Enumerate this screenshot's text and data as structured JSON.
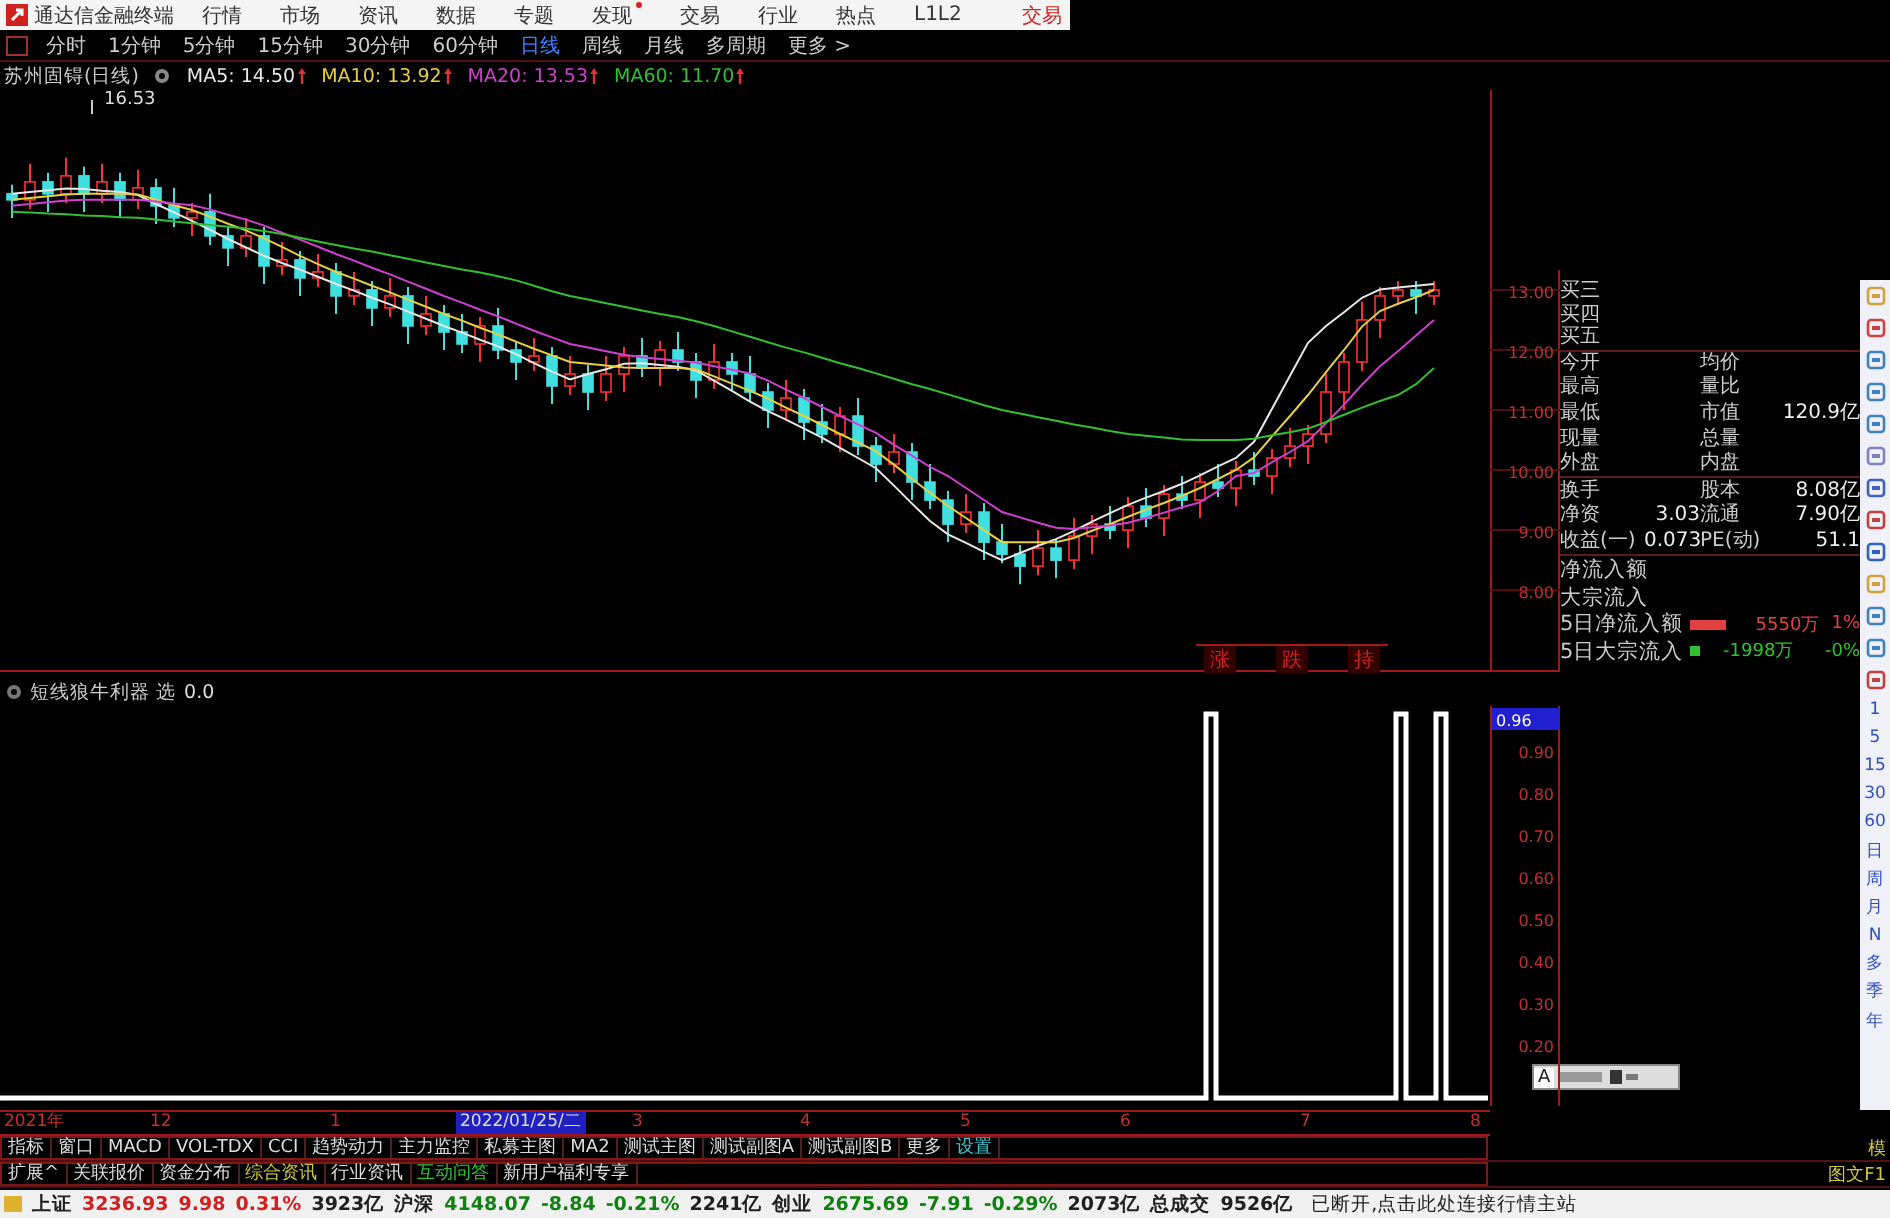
{
  "menu": {
    "title": "通达信金融终端",
    "items": [
      {
        "label": "行情",
        "badge": false
      },
      {
        "label": "市场",
        "badge": false
      },
      {
        "label": "资讯",
        "badge": false
      },
      {
        "label": "数据",
        "badge": false
      },
      {
        "label": "专题",
        "badge": false
      },
      {
        "label": "发现",
        "badge": true
      },
      {
        "label": "交易",
        "badge": false
      },
      {
        "label": "行业",
        "badge": false
      },
      {
        "label": "热点",
        "badge": false
      },
      {
        "label": "L1L2",
        "badge": false
      }
    ],
    "trade": "交易"
  },
  "periods": [
    {
      "label": "分时",
      "selected": false
    },
    {
      "label": "1分钟",
      "selected": false
    },
    {
      "label": "5分钟",
      "selected": false
    },
    {
      "label": "15分钟",
      "selected": false
    },
    {
      "label": "30分钟",
      "selected": false
    },
    {
      "label": "60分钟",
      "selected": false
    },
    {
      "label": "日线",
      "selected": true
    },
    {
      "label": "周线",
      "selected": false
    },
    {
      "label": "月线",
      "selected": false
    },
    {
      "label": "多周期",
      "selected": false
    },
    {
      "label": "更多 >",
      "selected": false
    }
  ],
  "ma_bar": {
    "stock": "苏州固锝(日线)",
    "lines": [
      "MA5: 14.50",
      "MA10: 13.92",
      "MA20: 13.53",
      "MA60: 11.70"
    ]
  },
  "high_label": "16.53",
  "chart_tabs": [
    "涨",
    "跌",
    "持"
  ],
  "chart_data": {
    "type": "candlestick",
    "ylim": [
      6.67,
      16.33
    ],
    "ohlc": [
      [
        14.6,
        14.75,
        14.2,
        14.5
      ],
      [
        14.5,
        15.1,
        14.35,
        14.8
      ],
      [
        14.8,
        14.95,
        14.3,
        14.6
      ],
      [
        14.6,
        15.2,
        14.45,
        14.9
      ],
      [
        14.9,
        15.05,
        14.3,
        14.6
      ],
      [
        14.6,
        15.1,
        14.45,
        14.8
      ],
      [
        14.8,
        14.95,
        14.2,
        14.5
      ],
      [
        14.5,
        15.0,
        14.35,
        14.7
      ],
      [
        14.7,
        14.85,
        14.1,
        14.4
      ],
      [
        14.4,
        14.7,
        14.05,
        14.2
      ],
      [
        14.2,
        14.45,
        13.9,
        14.3
      ],
      [
        14.3,
        14.6,
        13.75,
        13.9
      ],
      [
        13.9,
        14.05,
        13.4,
        13.7
      ],
      [
        13.7,
        14.2,
        13.55,
        13.9
      ],
      [
        13.9,
        14.05,
        13.1,
        13.4
      ],
      [
        13.4,
        13.8,
        13.25,
        13.5
      ],
      [
        13.5,
        13.65,
        12.9,
        13.2
      ],
      [
        13.2,
        13.6,
        13.05,
        13.3
      ],
      [
        13.3,
        13.45,
        12.6,
        12.9
      ],
      [
        12.9,
        13.3,
        12.75,
        13.0
      ],
      [
        13.0,
        13.15,
        12.4,
        12.7
      ],
      [
        12.7,
        13.2,
        12.55,
        12.9
      ],
      [
        12.9,
        13.05,
        12.1,
        12.4
      ],
      [
        12.4,
        12.9,
        12.25,
        12.6
      ],
      [
        12.6,
        12.75,
        12.0,
        12.3
      ],
      [
        12.3,
        12.6,
        11.95,
        12.1
      ],
      [
        12.1,
        12.55,
        11.8,
        12.4
      ],
      [
        12.4,
        12.7,
        11.85,
        12.0
      ],
      [
        12.0,
        12.15,
        11.5,
        11.8
      ],
      [
        11.8,
        12.2,
        11.65,
        11.9
      ],
      [
        11.9,
        12.05,
        11.1,
        11.4
      ],
      [
        11.4,
        11.9,
        11.25,
        11.6
      ],
      [
        11.6,
        11.75,
        11.0,
        11.3
      ],
      [
        11.3,
        11.9,
        11.15,
        11.6
      ],
      [
        11.6,
        12.05,
        11.3,
        11.9
      ],
      [
        11.9,
        12.2,
        11.55,
        11.7
      ],
      [
        11.7,
        12.15,
        11.4,
        12.0
      ],
      [
        12.0,
        12.3,
        11.65,
        11.8
      ],
      [
        11.8,
        11.95,
        11.2,
        11.5
      ],
      [
        11.5,
        12.1,
        11.35,
        11.8
      ],
      [
        11.8,
        11.95,
        11.3,
        11.6
      ],
      [
        11.6,
        11.9,
        11.15,
        11.3
      ],
      [
        11.3,
        11.45,
        10.7,
        11.0
      ],
      [
        11.0,
        11.5,
        10.85,
        11.2
      ],
      [
        11.2,
        11.35,
        10.5,
        10.8
      ],
      [
        10.8,
        11.1,
        10.45,
        10.6
      ],
      [
        10.6,
        11.05,
        10.3,
        10.9
      ],
      [
        10.9,
        11.2,
        10.25,
        10.4
      ],
      [
        10.4,
        10.55,
        9.8,
        10.1
      ],
      [
        10.1,
        10.6,
        9.95,
        10.3
      ],
      [
        10.3,
        10.45,
        9.5,
        9.8
      ],
      [
        9.8,
        10.1,
        9.35,
        9.5
      ],
      [
        9.5,
        9.65,
        8.8,
        9.1
      ],
      [
        9.1,
        9.6,
        8.95,
        9.3
      ],
      [
        9.3,
        9.45,
        8.5,
        8.8
      ],
      [
        8.8,
        9.1,
        8.45,
        8.6
      ],
      [
        8.6,
        8.75,
        8.1,
        8.4
      ],
      [
        8.4,
        9.0,
        8.25,
        8.7
      ],
      [
        8.7,
        8.85,
        8.2,
        8.5
      ],
      [
        8.5,
        9.2,
        8.35,
        8.9
      ],
      [
        8.9,
        9.25,
        8.6,
        9.1
      ],
      [
        9.1,
        9.4,
        8.85,
        9.0
      ],
      [
        9.0,
        9.55,
        8.7,
        9.4
      ],
      [
        9.4,
        9.7,
        9.05,
        9.2
      ],
      [
        9.2,
        9.75,
        8.9,
        9.6
      ],
      [
        9.6,
        9.9,
        9.35,
        9.5
      ],
      [
        9.5,
        9.95,
        9.2,
        9.8
      ],
      [
        9.8,
        10.1,
        9.55,
        9.7
      ],
      [
        9.7,
        10.15,
        9.4,
        10.0
      ],
      [
        10.0,
        10.3,
        9.75,
        9.9
      ],
      [
        9.9,
        10.35,
        9.6,
        10.2
      ],
      [
        10.2,
        10.7,
        10.05,
        10.4
      ],
      [
        10.4,
        10.75,
        10.1,
        10.6
      ],
      [
        10.6,
        11.6,
        10.45,
        11.3
      ],
      [
        11.3,
        11.95,
        11.0,
        11.8
      ],
      [
        11.8,
        12.8,
        11.65,
        12.5
      ],
      [
        12.5,
        13.05,
        12.2,
        12.9
      ],
      [
        12.9,
        13.15,
        12.75,
        13.0
      ],
      [
        13.0,
        13.15,
        12.6,
        12.9
      ],
      [
        12.9,
        13.15,
        12.75,
        13.0
      ]
    ],
    "yticks": [
      {
        "value": 13,
        "label": "13.00"
      },
      {
        "value": 12,
        "label": "12.00"
      },
      {
        "value": 11,
        "label": "11.00"
      },
      {
        "value": 10,
        "label": "10.00"
      },
      {
        "value": 9,
        "label": "9.00"
      },
      {
        "value": 8,
        "label": "8.00"
      }
    ],
    "series": [
      {
        "type": "line",
        "color": "#e8e8e8",
        "values": [
          14.6,
          14.63,
          14.66,
          14.69,
          14.68,
          14.65,
          14.63,
          14.58,
          14.43,
          14.29,
          14.15,
          14.0,
          13.85,
          13.71,
          13.57,
          13.45,
          13.34,
          13.22,
          13.1,
          12.99,
          12.87,
          12.76,
          12.64,
          12.52,
          12.4,
          12.29,
          12.17,
          12.06,
          11.93,
          11.78,
          11.64,
          11.51,
          11.6,
          11.68,
          11.77,
          11.78,
          11.75,
          11.72,
          11.66,
          11.49,
          11.32,
          11.14,
          10.98,
          10.84,
          10.69,
          10.54,
          10.37,
          10.2,
          10.03,
          9.74,
          9.44,
          9.15,
          8.93,
          8.79,
          8.64,
          8.5,
          8.62,
          8.74,
          8.85,
          8.99,
          9.14,
          9.28,
          9.42,
          9.54,
          9.65,
          9.77,
          9.91,
          10.06,
          10.2,
          10.47,
          11.02,
          11.57,
          12.12,
          12.4,
          12.63,
          12.87,
          13.01,
          13.04,
          13.07,
          13.1
        ]
      },
      {
        "type": "line",
        "color": "#e8d040",
        "values": [
          14.5,
          14.53,
          14.56,
          14.59,
          14.6,
          14.6,
          14.6,
          14.59,
          14.5,
          14.41,
          14.33,
          14.22,
          14.1,
          13.99,
          13.86,
          13.72,
          13.57,
          13.43,
          13.3,
          13.19,
          13.07,
          12.96,
          12.84,
          12.72,
          12.6,
          12.49,
          12.37,
          12.26,
          12.14,
          12.02,
          11.91,
          11.8,
          11.77,
          11.74,
          11.71,
          11.7,
          11.7,
          11.7,
          11.68,
          11.56,
          11.44,
          11.32,
          11.19,
          11.04,
          10.9,
          10.75,
          10.6,
          10.46,
          10.31,
          10.09,
          9.85,
          9.62,
          9.4,
          9.2,
          9.0,
          8.8,
          8.8,
          8.8,
          8.8,
          8.87,
          8.99,
          9.1,
          9.22,
          9.34,
          9.45,
          9.57,
          9.7,
          9.85,
          10.0,
          10.21,
          10.56,
          10.9,
          11.25,
          11.63,
          12.0,
          12.39,
          12.65,
          12.77,
          12.88,
          13.0
        ]
      },
      {
        "type": "line",
        "color": "#d040d0",
        "values": [
          14.4,
          14.43,
          14.46,
          14.49,
          14.5,
          14.5,
          14.5,
          14.5,
          14.47,
          14.44,
          14.41,
          14.34,
          14.25,
          14.17,
          14.07,
          13.95,
          13.84,
          13.72,
          13.6,
          13.49,
          13.37,
          13.26,
          13.14,
          13.02,
          12.9,
          12.79,
          12.67,
          12.56,
          12.44,
          12.32,
          12.21,
          12.1,
          12.04,
          11.98,
          11.92,
          11.88,
          11.85,
          11.82,
          11.79,
          11.73,
          11.67,
          11.61,
          11.49,
          11.34,
          11.2,
          11.05,
          10.9,
          10.76,
          10.62,
          10.42,
          10.24,
          10.05,
          9.9,
          9.7,
          9.5,
          9.3,
          9.21,
          9.12,
          9.04,
          9.02,
          9.05,
          9.08,
          9.12,
          9.2,
          9.29,
          9.38,
          9.46,
          9.65,
          9.9,
          9.95,
          10.13,
          10.3,
          10.48,
          10.78,
          11.09,
          11.42,
          11.73,
          11.98,
          12.24,
          12.5
        ]
      },
      {
        "type": "line",
        "color": "#30c030",
        "values": [
          14.3,
          14.29,
          14.27,
          14.26,
          14.24,
          14.23,
          14.21,
          14.2,
          14.17,
          14.14,
          14.11,
          14.08,
          14.05,
          14.02,
          13.98,
          13.93,
          13.87,
          13.81,
          13.75,
          13.69,
          13.64,
          13.58,
          13.52,
          13.46,
          13.4,
          13.34,
          13.29,
          13.23,
          13.16,
          13.07,
          12.98,
          12.9,
          12.84,
          12.78,
          12.72,
          12.66,
          12.6,
          12.55,
          12.48,
          12.4,
          12.31,
          12.22,
          12.13,
          12.04,
          11.96,
          11.87,
          11.78,
          11.7,
          11.61,
          11.52,
          11.43,
          11.35,
          11.26,
          11.17,
          11.08,
          11.0,
          10.94,
          10.88,
          10.82,
          10.76,
          10.71,
          10.65,
          10.6,
          10.57,
          10.54,
          10.51,
          10.5,
          10.5,
          10.5,
          10.52,
          10.58,
          10.63,
          10.69,
          10.8,
          10.92,
          11.04,
          11.15,
          11.25,
          11.43,
          11.7
        ]
      }
    ]
  },
  "indicator": {
    "title": "短线狼牛利器 选",
    "value": "0.0"
  },
  "indicator_axis": {
    "current": "0.96",
    "ticks": [
      "0.90",
      "0.80",
      "0.70",
      "0.60",
      "0.50",
      "0.40",
      "0.30",
      "0.20"
    ]
  },
  "info": {
    "quotes": [
      "买三",
      "买四",
      "买五"
    ],
    "stats": [
      {
        "label": "今开",
        "label2": "均价"
      },
      {
        "label": "最高",
        "label2": "量比"
      },
      {
        "label": "最低",
        "label2": "市值",
        "value2": "120.9亿"
      },
      {
        "label": "现量",
        "label2": "总量"
      },
      {
        "label": "外盘",
        "label2": "内盘"
      },
      {
        "label": "换手",
        "label2": "股本",
        "value2": "8.08亿"
      },
      {
        "label": "净资",
        "value": "3.03",
        "label2": "流通",
        "value2": "7.90亿"
      },
      {
        "label": "收益(一)",
        "value": "0.073",
        "label2": "PE(动)",
        "value2": "51.1"
      }
    ],
    "flows": [
      {
        "label": "净流入额"
      },
      {
        "label": "大宗流入"
      }
    ],
    "flows5": [
      {
        "label": "5日净流入额",
        "color": "#e04040",
        "amount": "5550万",
        "pct": "1%"
      },
      {
        "label": "5日大宗流入",
        "color": "#30c030",
        "amount": "-1998万",
        "pct": "-0%"
      }
    ]
  },
  "floating_tool": "A",
  "side_periods": [
    "1",
    "5",
    "15",
    "30",
    "60",
    "日",
    "周",
    "月",
    "N",
    "多",
    "季",
    "年"
  ],
  "date_axis": [
    {
      "label": "2021年",
      "selected": false
    },
    {
      "label": "12",
      "selected": false
    },
    {
      "label": "1",
      "selected": false
    },
    {
      "label": "2022/01/25/二",
      "selected": true
    },
    {
      "label": "3",
      "selected": false
    },
    {
      "label": "4",
      "selected": false
    },
    {
      "label": "5",
      "selected": false
    },
    {
      "label": "6",
      "selected": false
    },
    {
      "label": "7",
      "selected": false
    },
    {
      "label": "8",
      "selected": false
    }
  ],
  "indicator_tabs": [
    {
      "label": "指标",
      "kind": "normal"
    },
    {
      "label": "窗口",
      "kind": "normal"
    },
    {
      "label": "MACD",
      "kind": "normal"
    },
    {
      "label": "VOL-TDX",
      "kind": "normal"
    },
    {
      "label": "CCI",
      "kind": "normal"
    },
    {
      "label": "趋势动力",
      "kind": "normal"
    },
    {
      "label": "主力监控",
      "kind": "normal"
    },
    {
      "label": "私募主图",
      "kind": "normal"
    },
    {
      "label": "MA2",
      "kind": "normal"
    },
    {
      "label": "测试主图",
      "kind": "normal"
    },
    {
      "label": "测试副图A",
      "kind": "normal"
    },
    {
      "label": "测试副图B",
      "kind": "normal"
    },
    {
      "label": "更多",
      "kind": "normal"
    },
    {
      "label": "设置",
      "kind": "settings"
    }
  ],
  "indicator_tabs_right": "模",
  "ext_tabs": [
    {
      "label": "扩展^",
      "kind": "normal"
    },
    {
      "label": "关联报价",
      "kind": "normal"
    },
    {
      "label": "资金分布",
      "kind": "normal"
    },
    {
      "label": "综合资讯",
      "kind": "highlight"
    },
    {
      "label": "行业资讯",
      "kind": "normal"
    },
    {
      "label": "互动问答",
      "kind": "green"
    },
    {
      "label": "新用户福利专享",
      "kind": "normal"
    }
  ],
  "ext_tabs_right": "图文F1",
  "status": {
    "items": [
      {
        "text": "上证",
        "kind": "name"
      },
      {
        "text": "3236.93",
        "kind": "up"
      },
      {
        "text": "9.98",
        "kind": "up"
      },
      {
        "text": "0.31%",
        "kind": "up"
      },
      {
        "text": "3923亿",
        "kind": "amount"
      },
      {
        "text": "沪深",
        "kind": "name"
      },
      {
        "text": "4148.07",
        "kind": "down"
      },
      {
        "text": "-8.84",
        "kind": "down"
      },
      {
        "text": "-0.21%",
        "kind": "down"
      },
      {
        "text": "2241亿",
        "kind": "amount"
      },
      {
        "text": "创业",
        "kind": "name"
      },
      {
        "text": "2675.69",
        "kind": "down"
      },
      {
        "text": "-7.91",
        "kind": "down"
      },
      {
        "text": "-0.29%",
        "kind": "down"
      },
      {
        "text": "2073亿",
        "kind": "amount"
      },
      {
        "text": "总成交",
        "kind": "name"
      },
      {
        "text": "9526亿",
        "kind": "amount"
      }
    ],
    "message": "已断开,点击此处连接行情主站"
  }
}
